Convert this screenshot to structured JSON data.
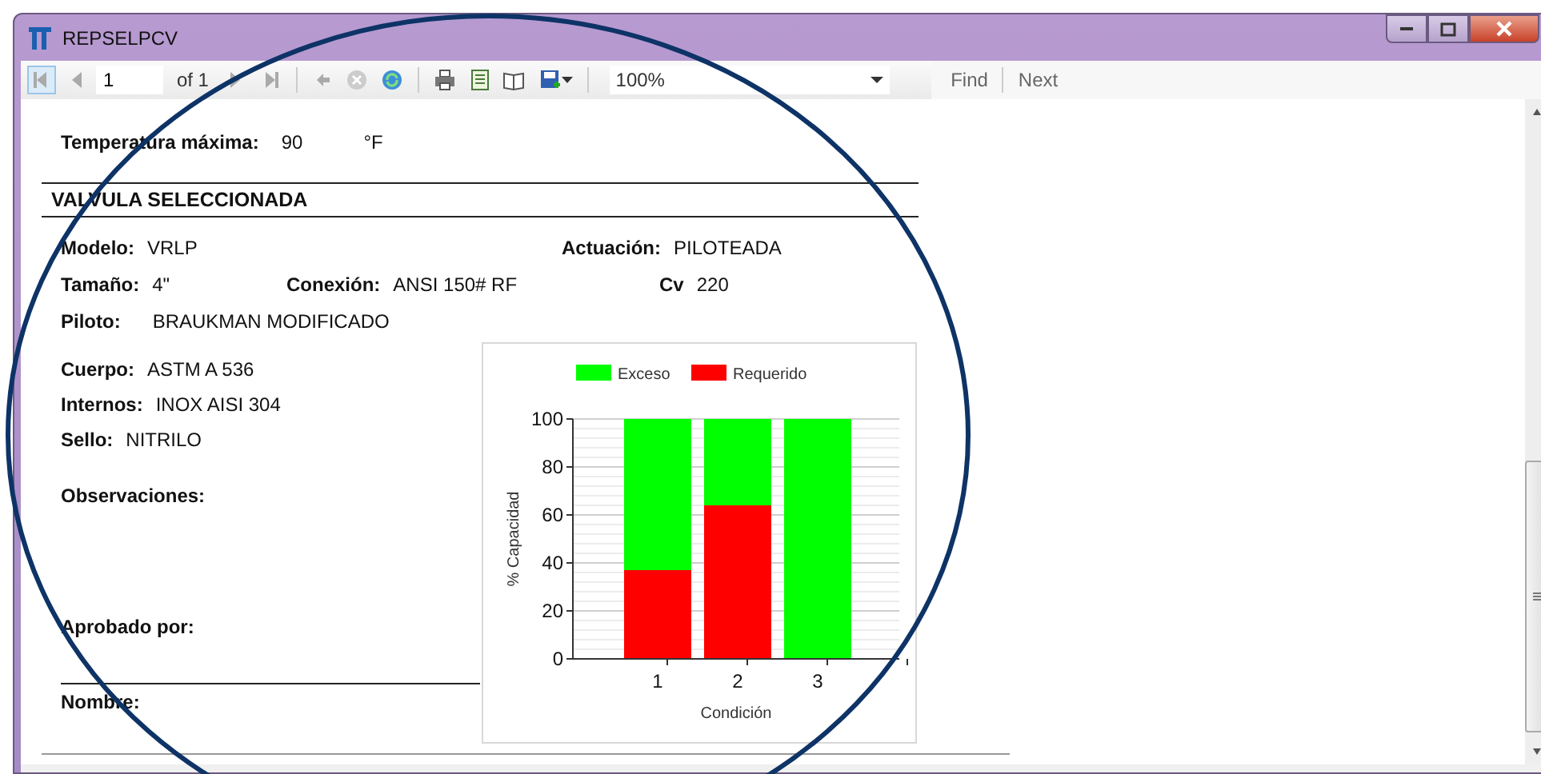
{
  "window": {
    "title": "REPSELPCV"
  },
  "toolbar": {
    "page": "1",
    "page_count": "of 1",
    "zoom": "100%",
    "find": "Find",
    "next": "Next"
  },
  "report": {
    "temperature": {
      "label": "Temperatura máxima:",
      "value": "90",
      "unit": "°F"
    },
    "section_title": "VALVULA SELECCIONADA",
    "spec_rows": [
      [
        {
          "label": "Modelo:",
          "value": "VRLP"
        },
        {
          "label": "Actuación:",
          "value": "PILOTEADA"
        }
      ],
      [
        {
          "label": "Tamaño:",
          "value": "4\""
        },
        {
          "label": "Conexión:",
          "value": "ANSI 150# RF"
        },
        {
          "label": "Cv",
          "value": "220"
        }
      ],
      [
        {
          "label": "Piloto:",
          "value": "BRAUKMAN MODIFICADO"
        }
      ]
    ],
    "materials": [
      {
        "label": "Cuerpo:",
        "value": "ASTM A 536"
      },
      {
        "label": "Internos:",
        "value": "INOX AISI 304"
      },
      {
        "label": "Sello:",
        "value": "NITRILO"
      }
    ],
    "observations_label": "Observaciones:",
    "approved_label": "Aprobado por:",
    "name_label": "Nombre:",
    "chart_data": {
      "type": "bar",
      "stacked": true,
      "grid": true,
      "legend": true,
      "xlabel": "Condición",
      "ylabel": "% Capacidad",
      "categories": [
        "1",
        "2",
        "3"
      ],
      "ylim": [
        0,
        100
      ],
      "yticks": [
        0,
        20,
        40,
        60,
        80,
        100
      ],
      "series": [
        {
          "name": "Exceso",
          "color": "#00ff00",
          "values": [
            63,
            36,
            100
          ]
        },
        {
          "name": "Requerido",
          "color": "#ff0000",
          "values": [
            37,
            64,
            0
          ]
        }
      ]
    }
  }
}
